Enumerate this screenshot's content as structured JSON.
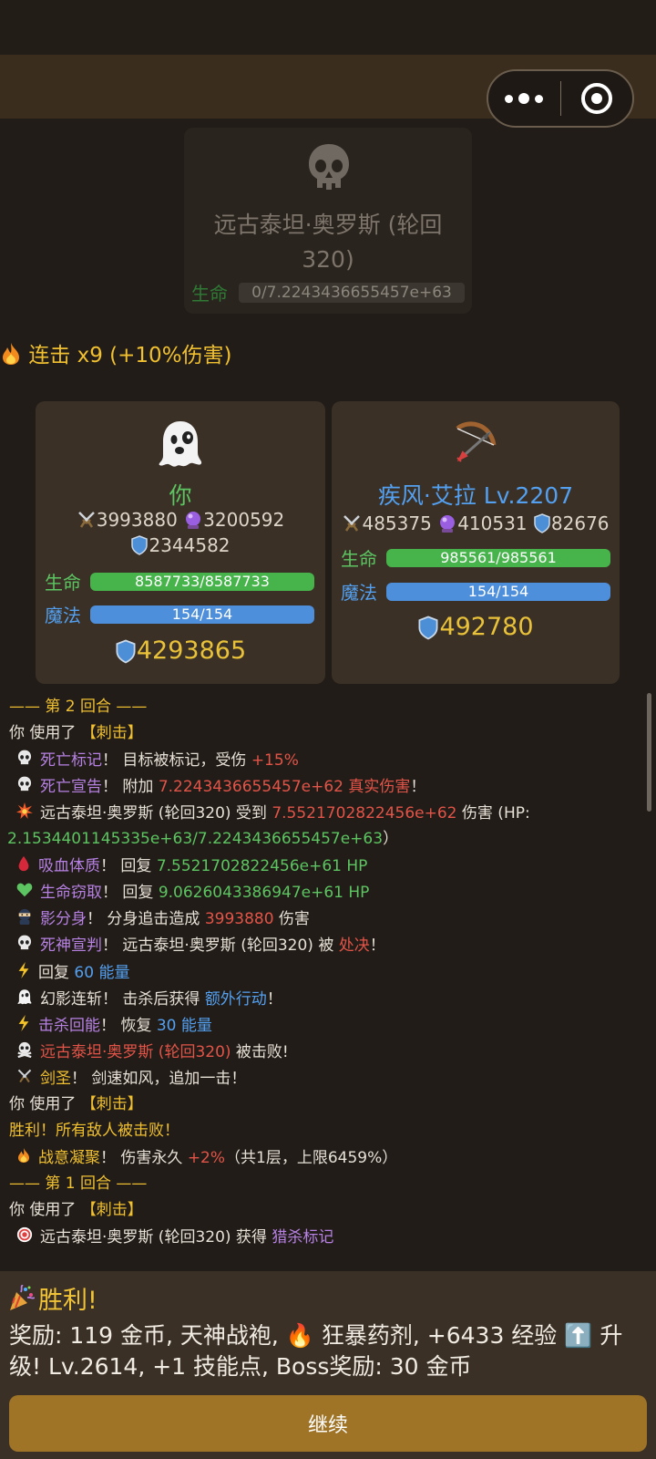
{
  "enemy": {
    "name": "远古泰坦·奥罗斯 (轮回320)",
    "hp_label": "生命",
    "hp_text": "0/7.2243436655457e+63",
    "hp_fraction": 0,
    "icon": "skull-icon"
  },
  "combo": {
    "text": "连击 x9 (+10%伤害)",
    "icon": "fire-icon"
  },
  "player": {
    "name": "你",
    "icon": "ghost-icon",
    "attack": "3993880",
    "magic": "3200592",
    "defense": "2344582",
    "hp_label": "生命",
    "hp_text": "8587733/8587733",
    "hp_fraction": 1,
    "mp_label": "魔法",
    "mp_text": "154/154",
    "mp_fraction": 1,
    "shield": "4293865"
  },
  "ally": {
    "name": "疾风·艾拉 Lv.2207",
    "icon": "bow-icon",
    "attack": "485375",
    "magic": "410531",
    "defense": "82676",
    "hp_label": "生命",
    "hp_text": "985561/985561",
    "hp_fraction": 1,
    "mp_label": "魔法",
    "mp_text": "154/154",
    "mp_fraction": 1,
    "shield": "492780"
  },
  "colors": {
    "green": "#5cc561",
    "blue": "#4e8fdb",
    "gold": "#f0c030",
    "red": "#e25448",
    "purple": "#b681e3"
  },
  "log": [
    {
      "icon": "",
      "parts": [
        {
          "t": "—— 第 2 回合 ——",
          "c": "gold"
        }
      ]
    },
    {
      "icon": "",
      "parts": [
        {
          "t": "你  使用了 ",
          "c": "white"
        },
        {
          "t": "【刺击】",
          "c": "gold"
        }
      ]
    },
    {
      "icon": "skull-icon",
      "parts": [
        {
          "t": "死亡标记",
          "c": "purple"
        },
        {
          "t": "！ 目标被标记，受伤 ",
          "c": "white"
        },
        {
          "t": "+15%",
          "c": "red"
        }
      ]
    },
    {
      "icon": "skull-icon",
      "parts": [
        {
          "t": "死亡宣告",
          "c": "purple"
        },
        {
          "t": "！ 附加 ",
          "c": "white"
        },
        {
          "t": "7.2243436655457e+62 真实伤害",
          "c": "red"
        },
        {
          "t": "！",
          "c": "white"
        }
      ]
    },
    {
      "icon": "explosion-icon",
      "parts": [
        {
          "t": "远古泰坦·奥罗斯 (轮回320) 受到 ",
          "c": "white"
        },
        {
          "t": "7.5521702822456e+62",
          "c": "red"
        },
        {
          "t": " 伤害 (HP:",
          "c": "white"
        }
      ]
    },
    {
      "icon": "",
      "parts": [
        {
          "t": "2.1534401145335e+63/7.2243436655457e+63",
          "c": "green"
        },
        {
          "t": "）",
          "c": "white"
        }
      ]
    },
    {
      "icon": "blood-drop-icon",
      "parts": [
        {
          "t": "吸血体质",
          "c": "purple"
        },
        {
          "t": "！ 回复 ",
          "c": "white"
        },
        {
          "t": "7.5521702822456e+61 HP",
          "c": "green"
        }
      ]
    },
    {
      "icon": "green-heart-icon",
      "parts": [
        {
          "t": "生命窃取",
          "c": "purple"
        },
        {
          "t": "！ 回复 ",
          "c": "white"
        },
        {
          "t": "9.0626043386947e+61 HP",
          "c": "green"
        }
      ]
    },
    {
      "icon": "ninja-icon",
      "parts": [
        {
          "t": "影分身",
          "c": "purple"
        },
        {
          "t": "！ 分身追击造成 ",
          "c": "white"
        },
        {
          "t": "3993880",
          "c": "red"
        },
        {
          "t": " 伤害",
          "c": "white"
        }
      ]
    },
    {
      "icon": "skull-icon",
      "parts": [
        {
          "t": "死神宣判",
          "c": "purple"
        },
        {
          "t": "！ 远古泰坦·奥罗斯 (轮回320) 被 ",
          "c": "white"
        },
        {
          "t": "处决",
          "c": "red"
        },
        {
          "t": "！",
          "c": "white"
        }
      ]
    },
    {
      "icon": "lightning-icon",
      "parts": [
        {
          "t": "回复 ",
          "c": "white"
        },
        {
          "t": "60 能量",
          "c": "blue"
        }
      ]
    },
    {
      "icon": "ghost-icon",
      "parts": [
        {
          "t": "幻影连斩！ 击杀后获得 ",
          "c": "white"
        },
        {
          "t": "额外行动",
          "c": "blue"
        },
        {
          "t": "！",
          "c": "white"
        }
      ]
    },
    {
      "icon": "lightning-icon",
      "parts": [
        {
          "t": "击杀回能",
          "c": "purple"
        },
        {
          "t": "！ 恢复 ",
          "c": "white"
        },
        {
          "t": "30 能量",
          "c": "blue"
        }
      ]
    },
    {
      "icon": "skull-crossbones-icon",
      "parts": [
        {
          "t": "远古泰坦·奥罗斯 (轮回320)",
          "c": "red"
        },
        {
          "t": " 被击败!",
          "c": "white"
        }
      ]
    },
    {
      "icon": "crossed-swords-icon",
      "parts": [
        {
          "t": "剑圣",
          "c": "gold"
        },
        {
          "t": "！ 剑速如风，追加一击！",
          "c": "white"
        }
      ]
    },
    {
      "icon": "",
      "parts": [
        {
          "t": "你  使用了 ",
          "c": "white"
        },
        {
          "t": "【刺击】",
          "c": "gold"
        }
      ]
    },
    {
      "icon": "",
      "parts": [
        {
          "t": "胜利！所有敌人被击败！",
          "c": "gold"
        }
      ]
    },
    {
      "icon": "fire-icon",
      "parts": [
        {
          "t": "战意凝聚",
          "c": "gold"
        },
        {
          "t": "！ 伤害永久 ",
          "c": "white"
        },
        {
          "t": "+2%",
          "c": "red"
        },
        {
          "t": "（共1层，上限6459%）",
          "c": "white"
        }
      ]
    },
    {
      "icon": "",
      "parts": [
        {
          "t": "—— 第 1 回合 ——",
          "c": "gold"
        }
      ]
    },
    {
      "icon": "",
      "parts": [
        {
          "t": "你  使用了 ",
          "c": "white"
        },
        {
          "t": "【刺击】",
          "c": "gold"
        }
      ]
    },
    {
      "icon": "target-icon",
      "parts": [
        {
          "t": "远古泰坦·奥罗斯 (轮回320) 获得 ",
          "c": "white"
        },
        {
          "t": "猎杀标记",
          "c": "purple"
        }
      ]
    }
  ],
  "victory": {
    "title": "胜利!",
    "reward": "奖励: 119 金币, 天神战袍, 🔥 狂暴药剂, +6433 经验 ⬆️ 升级! Lv.2614, +1 技能点, Boss奖励: 30 金币",
    "continue_label": "继续"
  }
}
